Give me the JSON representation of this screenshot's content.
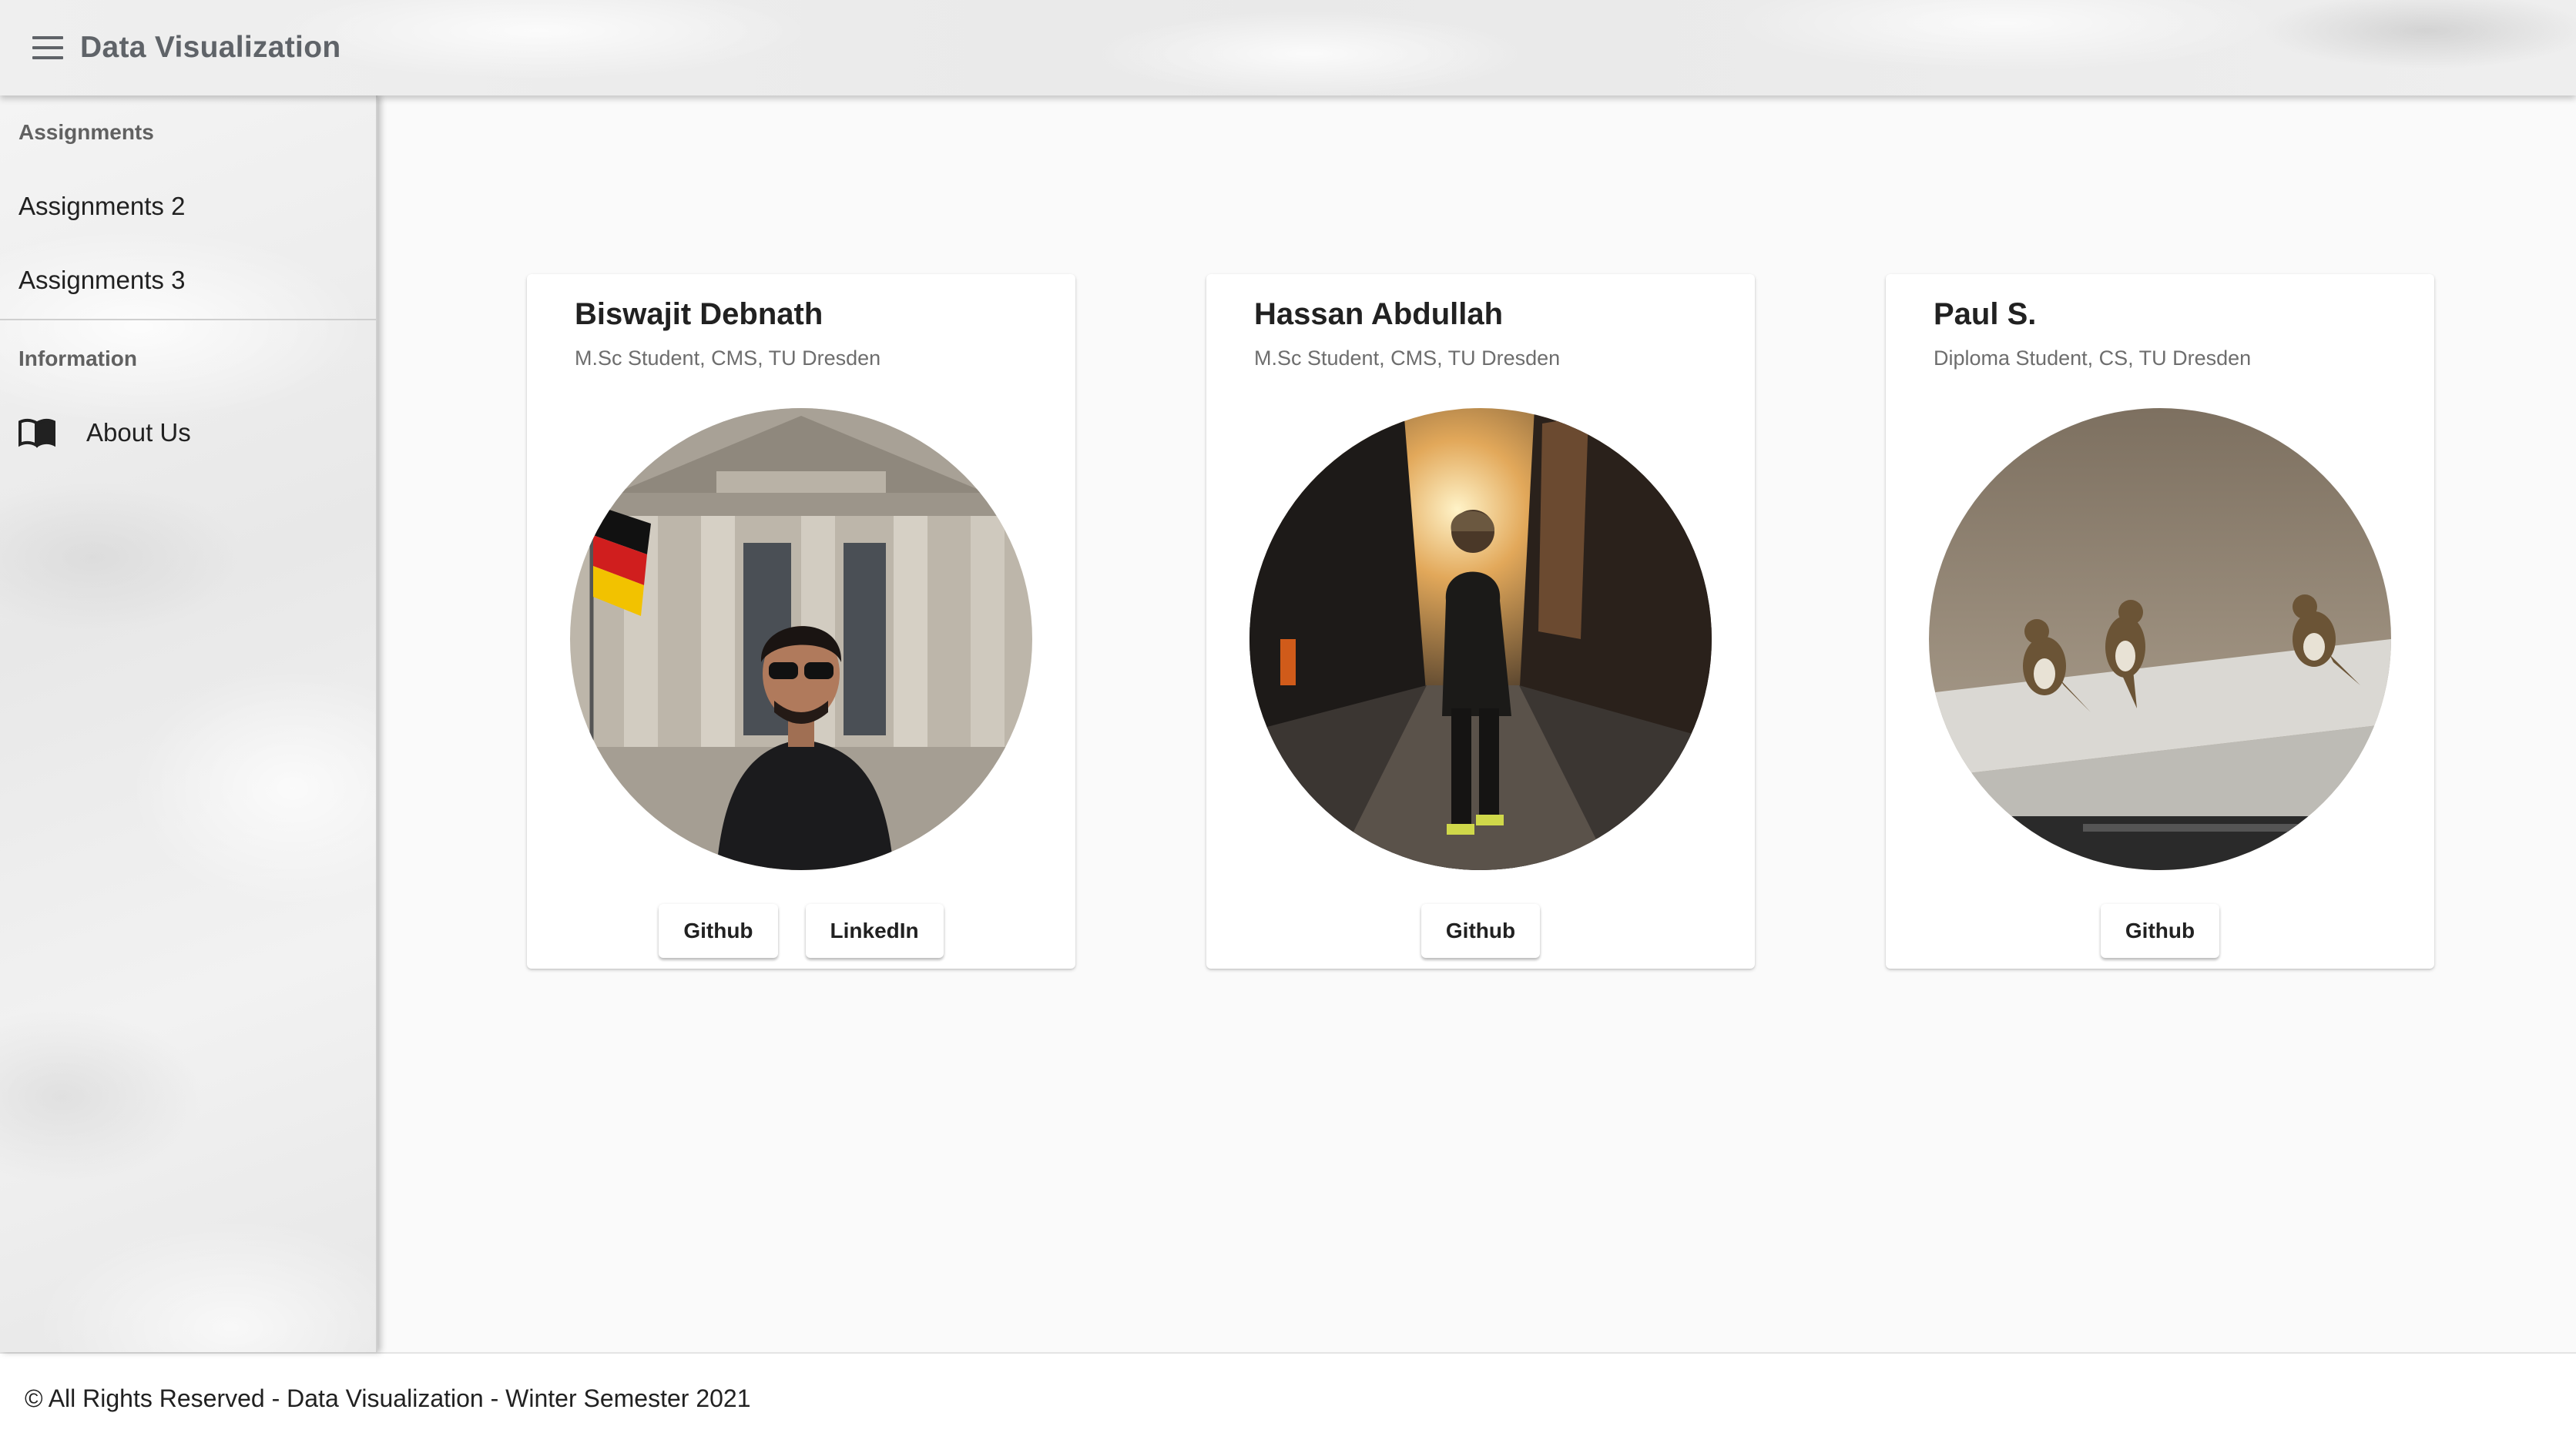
{
  "app": {
    "title": "Data Visualization"
  },
  "sidebar": {
    "sections": [
      {
        "header": "Assignments",
        "items": [
          {
            "label": "Assignments 2"
          },
          {
            "label": "Assignments 3"
          }
        ]
      },
      {
        "header": "Information",
        "items": [
          {
            "label": "About Us",
            "icon": "book-icon"
          }
        ]
      }
    ]
  },
  "members": [
    {
      "name": "Biswajit Debnath",
      "role": "M.Sc Student, CMS, TU Dresden",
      "buttons": [
        "Github",
        "LinkedIn"
      ],
      "photo": "photo-reichstag-portrait"
    },
    {
      "name": "Hassan Abdullah",
      "role": "M.Sc Student, CMS, TU Dresden",
      "buttons": [
        "Github"
      ],
      "photo": "photo-city-street"
    },
    {
      "name": "Paul S.",
      "role": "Diploma Student, CS, TU Dresden",
      "buttons": [
        "Github"
      ],
      "photo": "photo-sparrows"
    }
  ],
  "footer": {
    "text": "© All Rights Reserved - Data Visualization - Winter Semester 2021"
  },
  "colors": {
    "header_text": "#5f6368",
    "page_bg": "#fafafa",
    "card_bg": "#ffffff"
  }
}
